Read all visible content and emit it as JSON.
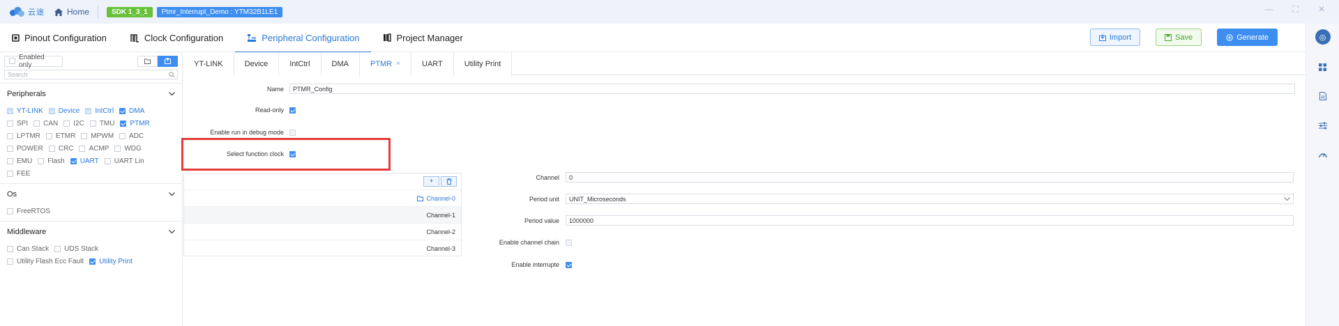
{
  "titlebar": {
    "logo_text": "云途",
    "home_label": "Home",
    "sdk_badge": "SDK 1_3_1",
    "project_badge": "Ptmr_Interrupt_Demo : YTM32B1LE1",
    "controls": [
      "—",
      "⛶",
      "✕"
    ]
  },
  "main_tabs": [
    {
      "label": "Pinout Configuration",
      "icon": "chip-icon"
    },
    {
      "label": "Clock Configuration",
      "icon": "clock-wave-icon"
    },
    {
      "label": "Peripheral Configuration",
      "icon": "peripheral-icon",
      "active": true
    },
    {
      "label": "Project Manager",
      "icon": "project-icon"
    }
  ],
  "actions": {
    "import_label": "Import",
    "save_label": "Save",
    "generate_label": "Generate"
  },
  "sidebar": {
    "enabled_only_label": "Enabled only",
    "search_placeholder": "Search",
    "sections": [
      {
        "title": "Peripherals",
        "items": [
          {
            "label": "YT-LINK",
            "checked": true,
            "disabled": true
          },
          {
            "label": "Device",
            "checked": true,
            "disabled": true
          },
          {
            "label": "IntCtrl",
            "checked": true,
            "disabled": true
          },
          {
            "label": "DMA",
            "checked": true
          },
          {
            "label": "SPI",
            "checked": false
          },
          {
            "label": "CAN",
            "checked": false
          },
          {
            "label": "I2C",
            "checked": false
          },
          {
            "label": "TMU",
            "checked": false
          },
          {
            "label": "PTMR",
            "checked": true
          },
          {
            "label": "LPTMR",
            "checked": false
          },
          {
            "label": "ETMR",
            "checked": false
          },
          {
            "label": "MPWM",
            "checked": false
          },
          {
            "label": "ADC",
            "checked": false
          },
          {
            "label": "POWER",
            "checked": false
          },
          {
            "label": "CRC",
            "checked": false
          },
          {
            "label": "ACMP",
            "checked": false
          },
          {
            "label": "WDG",
            "checked": false
          },
          {
            "label": "EMU",
            "checked": false
          },
          {
            "label": "Flash",
            "checked": false
          },
          {
            "label": "UART",
            "checked": true
          },
          {
            "label": "UART Lin",
            "checked": false
          },
          {
            "label": "FEE",
            "checked": false
          }
        ]
      },
      {
        "title": "Os",
        "items": [
          {
            "label": "FreeRTOS",
            "checked": false
          }
        ]
      },
      {
        "title": "Middleware",
        "items": [
          {
            "label": "Can Stack",
            "checked": false
          },
          {
            "label": "UDS Stack",
            "checked": false
          },
          {
            "label": "Utility Flash Ecc Fault",
            "checked": false
          },
          {
            "label": "Utility Print",
            "checked": true
          }
        ]
      }
    ]
  },
  "sub_tabs": [
    {
      "label": "YT-LINK"
    },
    {
      "label": "Device"
    },
    {
      "label": "IntCtrl"
    },
    {
      "label": "DMA"
    },
    {
      "label": "PTMR",
      "active": true,
      "close": "×"
    },
    {
      "label": "UART"
    },
    {
      "label": "Utility Print"
    }
  ],
  "form": {
    "name_label": "Name",
    "name_value": "PTMR_Config",
    "readonly_label": "Read-only",
    "debug_label": "Enable run in debug mode",
    "func_clock_label": "Select function clock"
  },
  "channels": {
    "group_label": "Channel-0",
    "rows": [
      "Channel-1",
      "Channel-2",
      "Channel-3"
    ]
  },
  "channel_form": {
    "channel_label": "Channel",
    "channel_value": "0",
    "period_unit_label": "Period unit",
    "period_unit_value": "UNIT_Microseconds",
    "period_value_label": "Period value",
    "period_value_value": "1000000",
    "chain_label": "Enable channel chain",
    "interrupt_label": "Enable interrupte"
  },
  "colors": {
    "accent": "#2a78d8",
    "primary_button": "#3d8ef0",
    "sdk_badge": "#67c23a",
    "highlight": "#e53a3a"
  }
}
